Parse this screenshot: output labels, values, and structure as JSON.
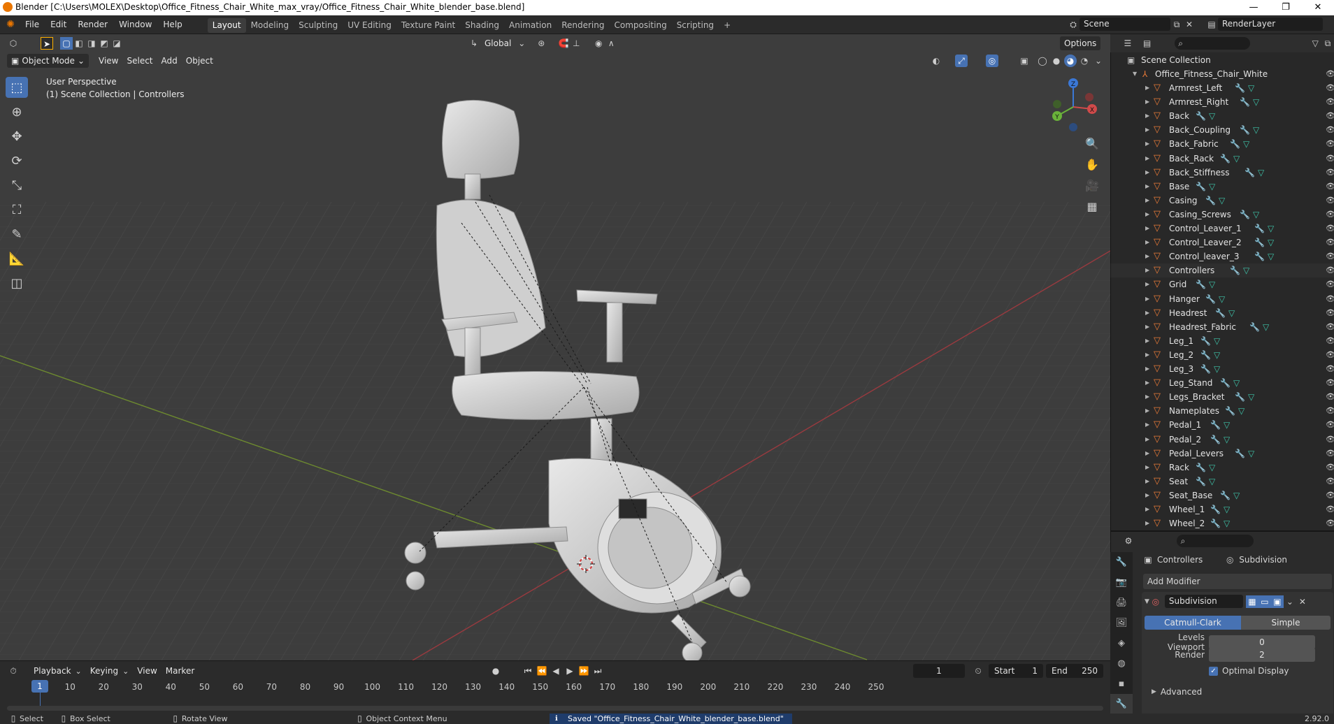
{
  "window": {
    "title": "Blender [C:\\Users\\MOLEX\\Desktop\\Office_Fitness_Chair_White_max_vray/Office_Fitness_Chair_White_blender_base.blend]",
    "minimize": "—",
    "maximize": "❐",
    "close": "✕"
  },
  "menu": [
    "File",
    "Edit",
    "Render",
    "Window",
    "Help"
  ],
  "workspaces": [
    "Layout",
    "Modeling",
    "Sculpting",
    "UV Editing",
    "Texture Paint",
    "Shading",
    "Animation",
    "Rendering",
    "Compositing",
    "Scripting"
  ],
  "workspace_add": "+",
  "active_workspace": "Layout",
  "scene": {
    "name": "Scene",
    "render_layer": "RenderLayer"
  },
  "viewport": {
    "mode": "Object Mode",
    "menus": [
      "View",
      "Select",
      "Add",
      "Object"
    ],
    "transform_orientation": "Global",
    "options_label": "Options",
    "perspective": "User Perspective",
    "collection_path": "(1) Scene Collection | Controllers",
    "gizmo_axes": {
      "z": "Z",
      "y": "Y",
      "x": "X"
    }
  },
  "timeline": {
    "menus": [
      "Playback",
      "Keying",
      "View",
      "Marker"
    ],
    "ticks": [
      "10",
      "20",
      "30",
      "40",
      "50",
      "60",
      "70",
      "80",
      "90",
      "100",
      "110",
      "120",
      "130",
      "140",
      "150",
      "160",
      "170",
      "180",
      "190",
      "200",
      "210",
      "220",
      "230",
      "240",
      "250"
    ],
    "current_frame": "1",
    "frame_field": "1",
    "start_label": "Start",
    "start_value": "1",
    "end_label": "End",
    "end_value": "250"
  },
  "outliner": {
    "root": "Scene Collection",
    "collection": "Office_Fitness_Chair_White",
    "objects": [
      "Armrest_Left",
      "Armrest_Right",
      "Back",
      "Back_Coupling",
      "Back_Fabric",
      "Back_Rack",
      "Back_Stiffness",
      "Base",
      "Casing",
      "Casing_Screws",
      "Control_Leaver_1",
      "Control_Leaver_2",
      "Control_leaver_3",
      "Controllers",
      "Grid",
      "Hanger",
      "Headrest",
      "Headrest_Fabric",
      "Leg_1",
      "Leg_2",
      "Leg_3",
      "Leg_Stand",
      "Legs_Bracket",
      "Nameplates",
      "Pedal_1",
      "Pedal_2",
      "Pedal_Levers",
      "Rack",
      "Seat",
      "Seat_Base",
      "Wheel_1",
      "Wheel_2"
    ]
  },
  "properties": {
    "object_name": "Controllers",
    "modifier_tab": "Subdivision",
    "add_modifier": "Add Modifier",
    "modifier_name": "Subdivision",
    "algo_options": [
      "Catmull-Clark",
      "Simple"
    ],
    "levels_viewport_label": "Levels Viewport",
    "levels_viewport_value": "0",
    "render_label": "Render",
    "render_value": "2",
    "optimal_display": "Optimal Display",
    "advanced": "Advanced"
  },
  "status": {
    "select": "Select",
    "box_select": "Box Select",
    "rotate_view": "Rotate View",
    "context_menu": "Object Context Menu",
    "saved_message": "Saved \"Office_Fitness_Chair_White_blender_base.blend\"",
    "version": "2.92.0"
  },
  "colors": {
    "accent": "#4772b3",
    "object_orange": "#ea7b38",
    "mesh_green": "#3ec4aa",
    "viewport_bg": "#3d3d3d"
  }
}
